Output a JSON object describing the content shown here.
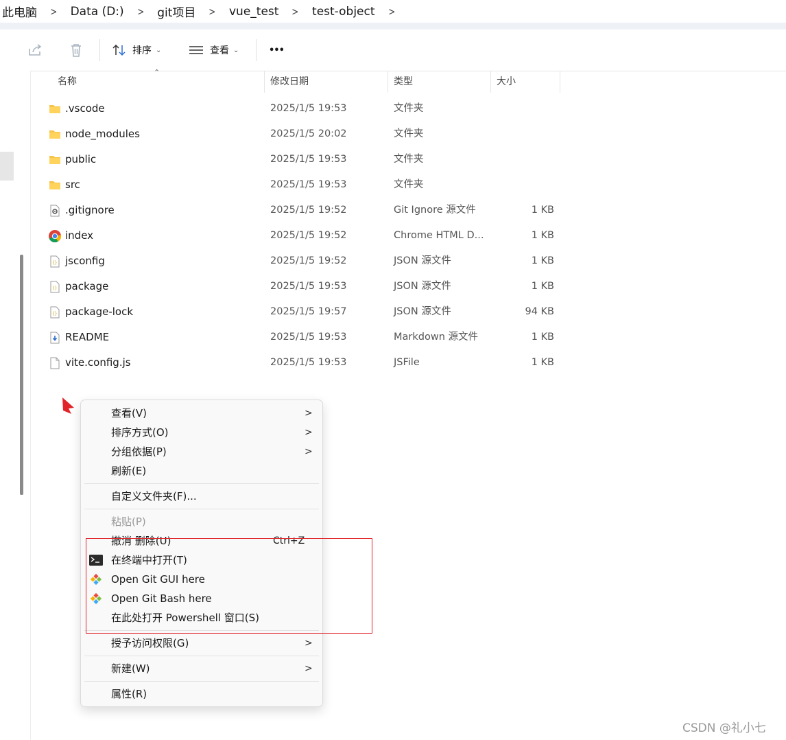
{
  "breadcrumb": [
    "此电脑",
    "Data (D:)",
    "git项目",
    "vue_test",
    "test-object"
  ],
  "toolbar": {
    "sort_label": "排序",
    "view_label": "查看",
    "more_label": "•••"
  },
  "columns": {
    "name": "名称",
    "date": "修改日期",
    "type": "类型",
    "size": "大小"
  },
  "files": [
    {
      "name": ".vscode",
      "date": "2025/1/5 19:53",
      "type": "文件夹",
      "size": "",
      "icon": "folder-icon"
    },
    {
      "name": "node_modules",
      "date": "2025/1/5 20:02",
      "type": "文件夹",
      "size": "",
      "icon": "folder-icon"
    },
    {
      "name": "public",
      "date": "2025/1/5 19:53",
      "type": "文件夹",
      "size": "",
      "icon": "folder-icon"
    },
    {
      "name": "src",
      "date": "2025/1/5 19:53",
      "type": "文件夹",
      "size": "",
      "icon": "folder-icon"
    },
    {
      "name": ".gitignore",
      "date": "2025/1/5 19:52",
      "type": "Git Ignore 源文件",
      "size": "1 KB",
      "icon": "gear-file-icon"
    },
    {
      "name": "index",
      "date": "2025/1/5 19:52",
      "type": "Chrome HTML D...",
      "size": "1 KB",
      "icon": "chrome-icon"
    },
    {
      "name": "jsconfig",
      "date": "2025/1/5 19:52",
      "type": "JSON 源文件",
      "size": "1 KB",
      "icon": "json-file-icon"
    },
    {
      "name": "package",
      "date": "2025/1/5 19:53",
      "type": "JSON 源文件",
      "size": "1 KB",
      "icon": "json-file-icon"
    },
    {
      "name": "package-lock",
      "date": "2025/1/5 19:57",
      "type": "JSON 源文件",
      "size": "94 KB",
      "icon": "json-file-icon"
    },
    {
      "name": "README",
      "date": "2025/1/5 19:53",
      "type": "Markdown 源文件",
      "size": "1 KB",
      "icon": "markdown-file-icon"
    },
    {
      "name": "vite.config.js",
      "date": "2025/1/5 19:53",
      "type": "JSFile",
      "size": "1 KB",
      "icon": "blank-file-icon"
    }
  ],
  "context_menu": {
    "view": "查看(V)",
    "sort": "排序方式(O)",
    "group": "分组依据(P)",
    "refresh": "刷新(E)",
    "customize": "自定义文件夹(F)...",
    "paste": "粘贴(P)",
    "undo": "撤消 删除(U)",
    "undo_shortcut": "Ctrl+Z",
    "terminal": "在终端中打开(T)",
    "git_gui": "Open Git GUI here",
    "git_bash": "Open Git Bash here",
    "powershell": "在此处打开 Powershell 窗口(S)",
    "access": "授予访问权限(G)",
    "new": "新建(W)",
    "properties": "属性(R)"
  },
  "watermark": "CSDN @礼小七",
  "colors": {
    "highlight_box": "#e0242a",
    "folder": "#f5c44a"
  }
}
